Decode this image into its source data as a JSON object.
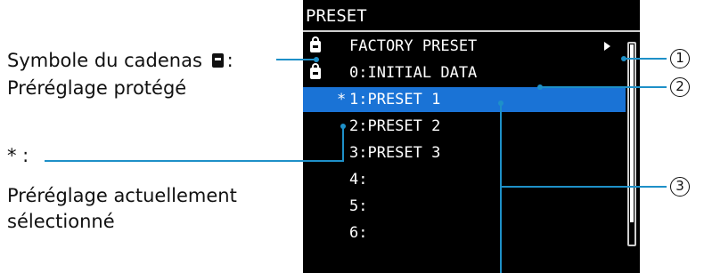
{
  "screen": {
    "title": "PRESET",
    "rows": [
      {
        "label": "FACTORY PRESET",
        "locked": true,
        "selected": false,
        "current_mark": "",
        "submenu_arrow": true
      },
      {
        "label": "0:INITIAL DATA",
        "locked": true,
        "selected": false,
        "current_mark": "",
        "submenu_arrow": false
      },
      {
        "label": "1:PRESET 1",
        "locked": false,
        "selected": true,
        "current_mark": "*",
        "submenu_arrow": false
      },
      {
        "label": "2:PRESET 2",
        "locked": false,
        "selected": false,
        "current_mark": "",
        "submenu_arrow": false
      },
      {
        "label": "3:PRESET 3",
        "locked": false,
        "selected": false,
        "current_mark": "",
        "submenu_arrow": false
      },
      {
        "label": "4:",
        "locked": false,
        "selected": false,
        "current_mark": "",
        "submenu_arrow": false
      },
      {
        "label": "5:",
        "locked": false,
        "selected": false,
        "current_mark": "",
        "submenu_arrow": false
      },
      {
        "label": "6:",
        "locked": false,
        "selected": false,
        "current_mark": "",
        "submenu_arrow": false
      }
    ],
    "colors": {
      "background": "#000000",
      "text": "#ffffff",
      "selection": "#1a73d6",
      "leader": "#1e90c8"
    }
  },
  "callouts": {
    "lock_line1_prefix": "Symbole du cadenas",
    "lock_line1_suffix": ":",
    "lock_line2": "Préréglage protégé",
    "star_line1": "* :",
    "star_line2": "Préréglage actuellement",
    "star_line3": "sélectionné"
  },
  "numbers": {
    "n1": "1",
    "n2": "2",
    "n3": "3"
  }
}
